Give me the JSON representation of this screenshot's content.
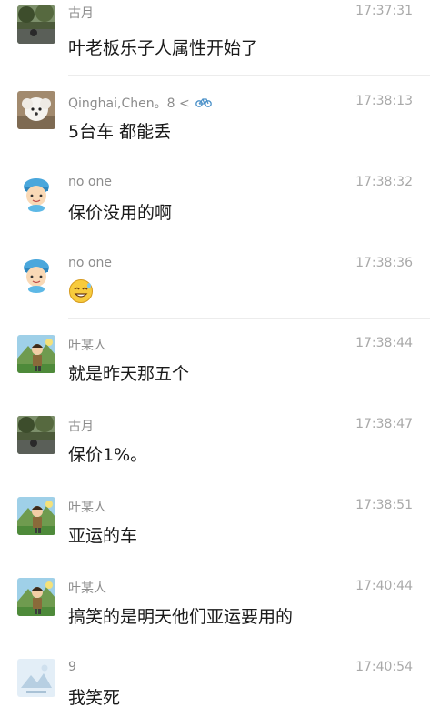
{
  "messages": [
    {
      "name": "古月",
      "time": "17:37:31",
      "text": "叶老板乐子人属性开始了",
      "avatar": "landscape-photo"
    },
    {
      "name": "Qinghai,Chen。8 <",
      "time": "17:38:13",
      "text": "5台车 都能丢",
      "avatar": "white-dog-photo",
      "name_icon": "bicycle-icon"
    },
    {
      "name": "no one",
      "time": "17:38:32",
      "text": "保价没用的啊",
      "avatar": "cartoon-boy"
    },
    {
      "name": "no one",
      "time": "17:38:36",
      "text": "",
      "avatar": "cartoon-boy",
      "emoji": "sweat-smile-emoji"
    },
    {
      "name": "叶某人",
      "time": "17:38:44",
      "text": "就是昨天那五个",
      "avatar": "cartoon-hiker"
    },
    {
      "name": "古月",
      "time": "17:38:47",
      "text": "保价1%。",
      "avatar": "landscape-photo"
    },
    {
      "name": "叶某人",
      "time": "17:38:51",
      "text": "亚运的车",
      "avatar": "cartoon-hiker"
    },
    {
      "name": "叶某人",
      "time": "17:40:44",
      "text": "搞笑的是明天他们亚运要用的",
      "avatar": "cartoon-hiker"
    },
    {
      "name": "9",
      "time": "17:40:54",
      "text": "我笑死",
      "avatar": "default-placeholder"
    }
  ]
}
